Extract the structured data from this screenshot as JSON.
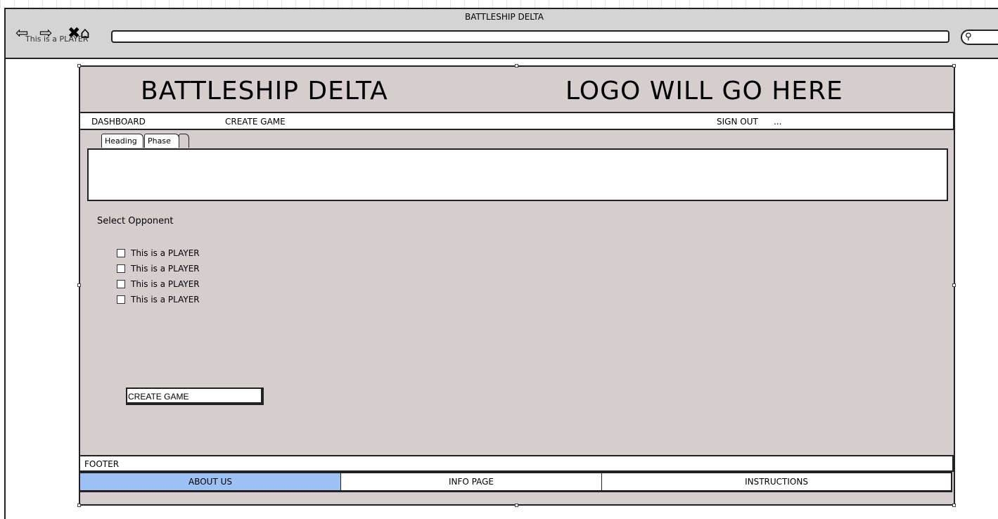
{
  "browser": {
    "window_title": "BATTLESHIP DELTA",
    "ghost_text": "This is a PLAYER",
    "url": "",
    "nav_icons": [
      "back-arrow-icon",
      "forward-arrow-icon",
      "stop-icon",
      "home-icon"
    ],
    "search_icon": "magnifier-icon"
  },
  "header": {
    "app_title": "BATTLESHIP DELTA",
    "logo_text": "LOGO WILL GO HERE"
  },
  "nav": {
    "dashboard": "DASHBOARD",
    "create_game": "CREATE GAME",
    "sign_out": "SIGN OUT",
    "more": "..."
  },
  "tabs": {
    "heading": "Heading",
    "phase": "Phase",
    "blank": ""
  },
  "opponent": {
    "label": "Select Opponent",
    "players": [
      {
        "label": "This is a PLAYER",
        "checked": false
      },
      {
        "label": "This is a PLAYER",
        "checked": false
      },
      {
        "label": "This is a PLAYER",
        "checked": false
      },
      {
        "label": "This is a PLAYER",
        "checked": false
      }
    ]
  },
  "actions": {
    "create_game_button": "CREATE GAME"
  },
  "footer": {
    "label": "FOOTER",
    "links": {
      "about": "ABOUT US",
      "info": "INFO PAGE",
      "instructions": "INSTRUCTIONS"
    },
    "active_color": "#9ec1f5"
  },
  "colors": {
    "page_background": "#d6cece",
    "titlebar": "#d4d4d4"
  }
}
